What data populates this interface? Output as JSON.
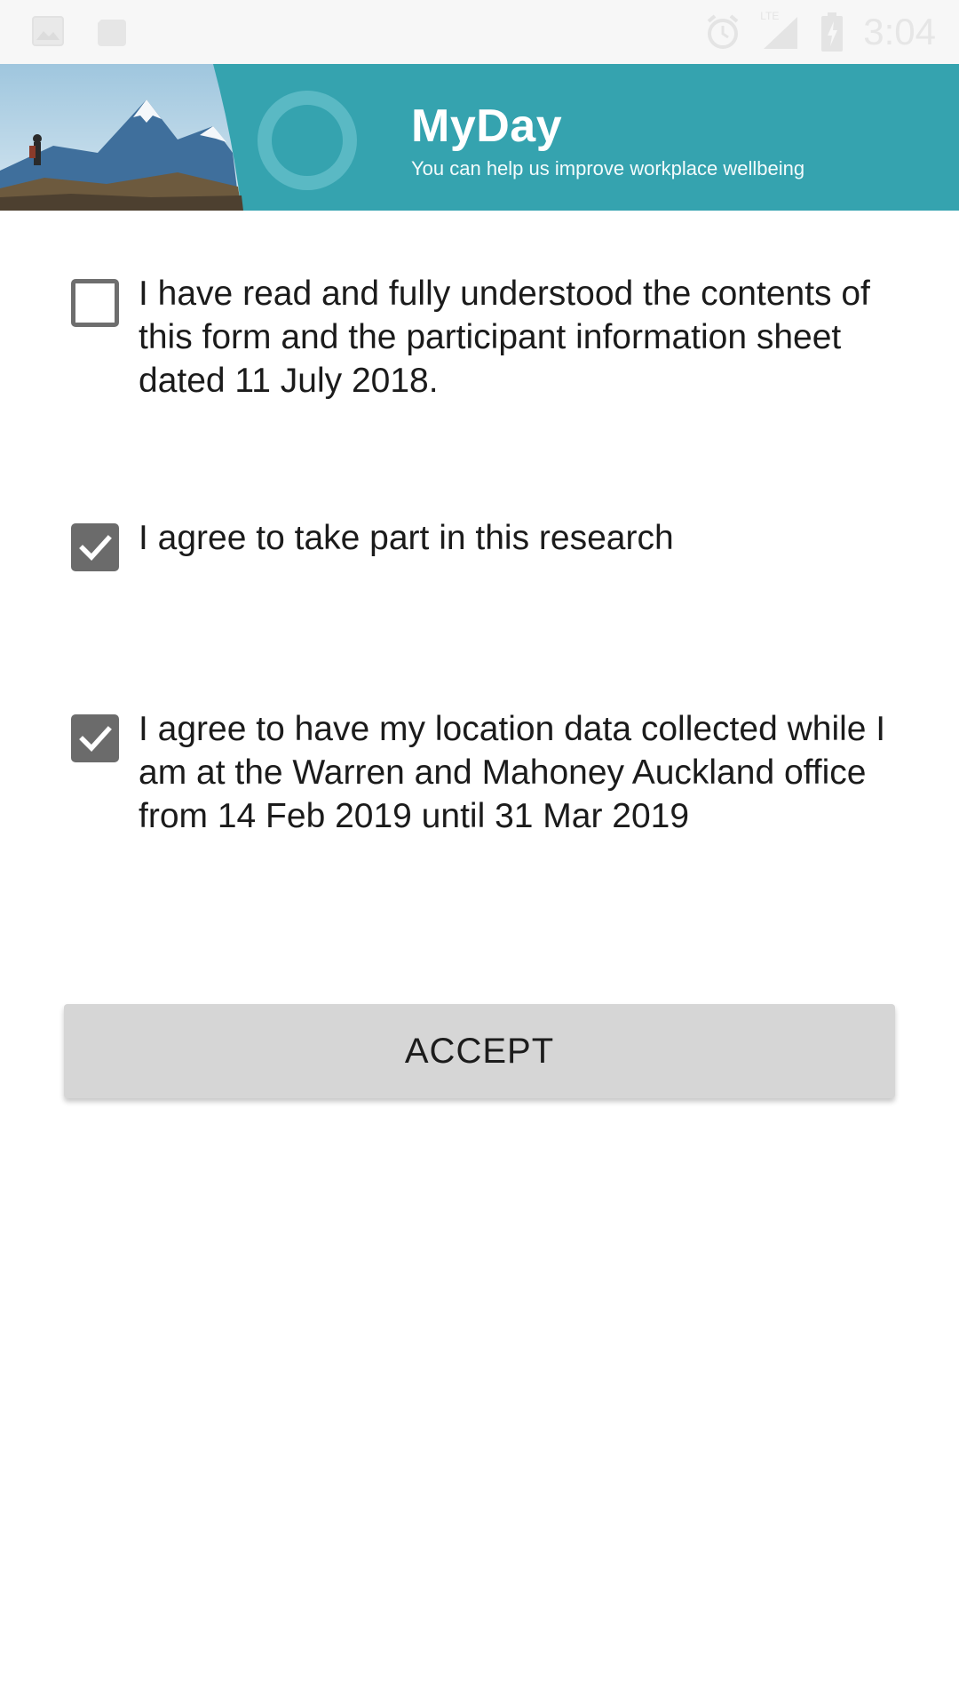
{
  "status_bar": {
    "left_icons": [
      "image-icon",
      "app-notification-icon"
    ],
    "right_icons": [
      "alarm-icon",
      "lte-signal-icon",
      "battery-charging-icon"
    ],
    "network_label": "LTE",
    "time": "3:04"
  },
  "banner": {
    "title": "MyDay",
    "subtitle": "You can help us improve workplace wellbeing",
    "background_color": "#35a3af"
  },
  "consents": [
    {
      "text": "I have read and fully understood the contents of this form and the participant information sheet dated 11 July 2018.",
      "checked": false
    },
    {
      "text": "I agree to take part in this research",
      "checked": true
    },
    {
      "text": "I agree to have my location data collected while I am at the Warren and Mahoney Auckland office from 14 Feb 2019 until 31 Mar 2019",
      "checked": true
    }
  ],
  "accept_button": {
    "label": "ACCEPT"
  }
}
